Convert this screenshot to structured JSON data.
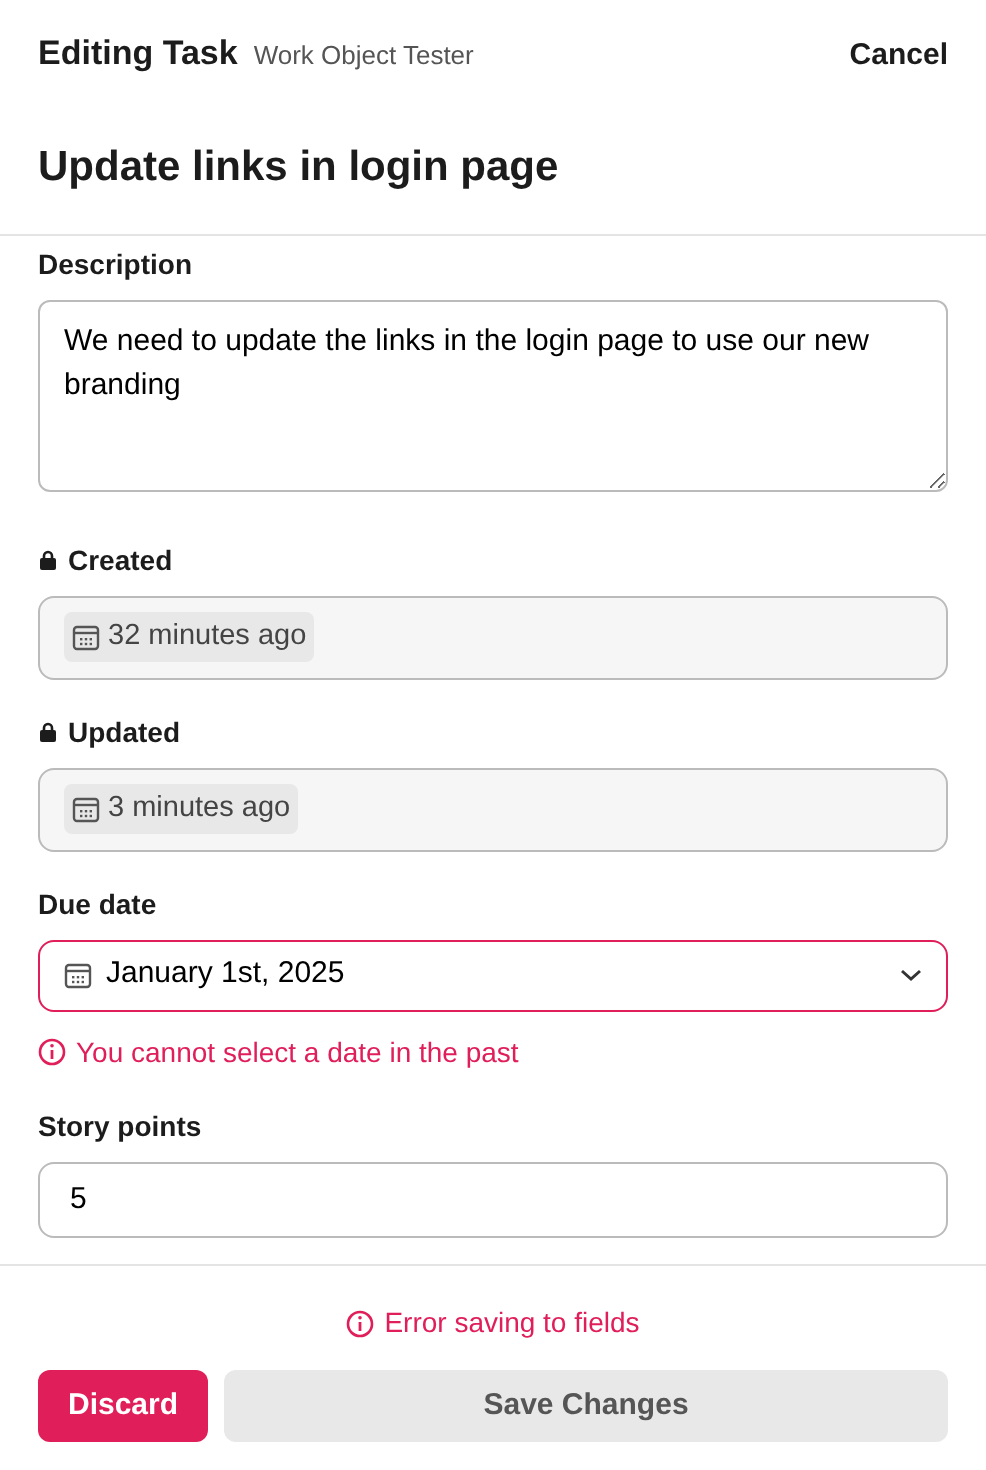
{
  "header": {
    "title": "Editing Task",
    "subtitle": "Work Object Tester",
    "cancel": "Cancel"
  },
  "task_title": "Update links in login page",
  "fields": [
    {
      "kind": "textarea",
      "label": "Description",
      "locked": false,
      "value": "We need to update the links in the login page to use our new branding"
    },
    {
      "kind": "readonly-date",
      "label": "Created",
      "locked": true,
      "value": "32 minutes ago"
    },
    {
      "kind": "readonly-date",
      "label": "Updated",
      "locked": true,
      "value": "3 minutes ago"
    },
    {
      "kind": "date-select",
      "label": "Due date",
      "locked": false,
      "value": "January 1st, 2025",
      "error": "You cannot select a date in the past"
    },
    {
      "kind": "number",
      "label": "Story points",
      "locked": false,
      "value": "5"
    }
  ],
  "footer": {
    "error": "Error saving to fields",
    "buttons": [
      {
        "label": "Discard",
        "kind": "danger"
      },
      {
        "label": "Save Changes",
        "kind": "disabled"
      }
    ]
  }
}
